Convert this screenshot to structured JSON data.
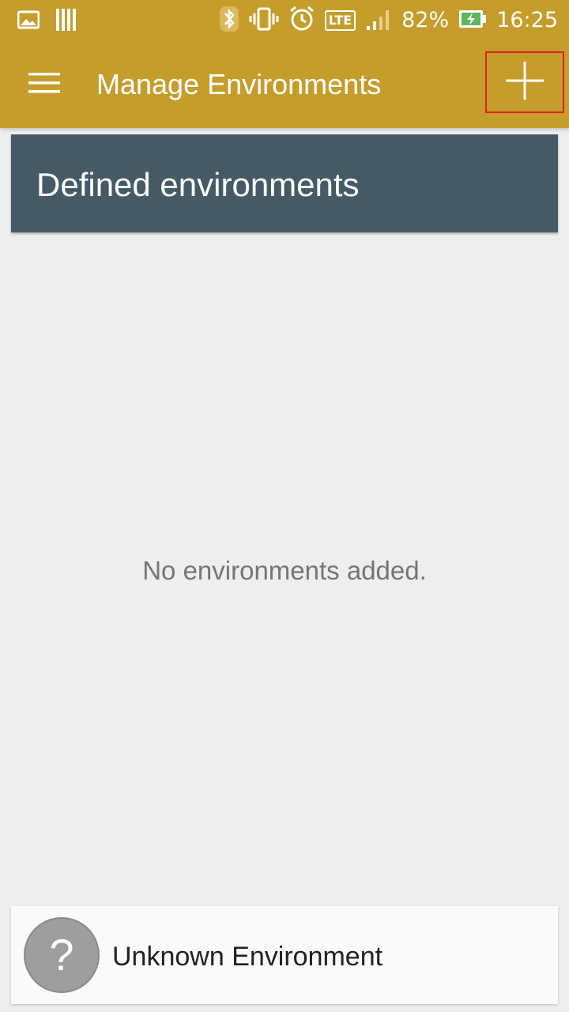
{
  "status_bar": {
    "battery_percent": "82%",
    "time": "16:25",
    "network": "LTE",
    "icons": [
      "image-icon",
      "sim-bars-icon",
      "bluetooth-icon",
      "vibrate-icon",
      "alarm-icon",
      "lte-icon",
      "signal-icon",
      "battery-charging-icon"
    ]
  },
  "app_bar": {
    "title": "Manage Environments",
    "menu_icon": "hamburger-menu-icon",
    "add_icon": "plus-icon",
    "color": "#c59d2b"
  },
  "section": {
    "title": "Defined environments",
    "color": "#455a64"
  },
  "empty_state": {
    "message": "No environments added."
  },
  "bottom_card": {
    "avatar_glyph": "?",
    "label": "Unknown Environment"
  }
}
